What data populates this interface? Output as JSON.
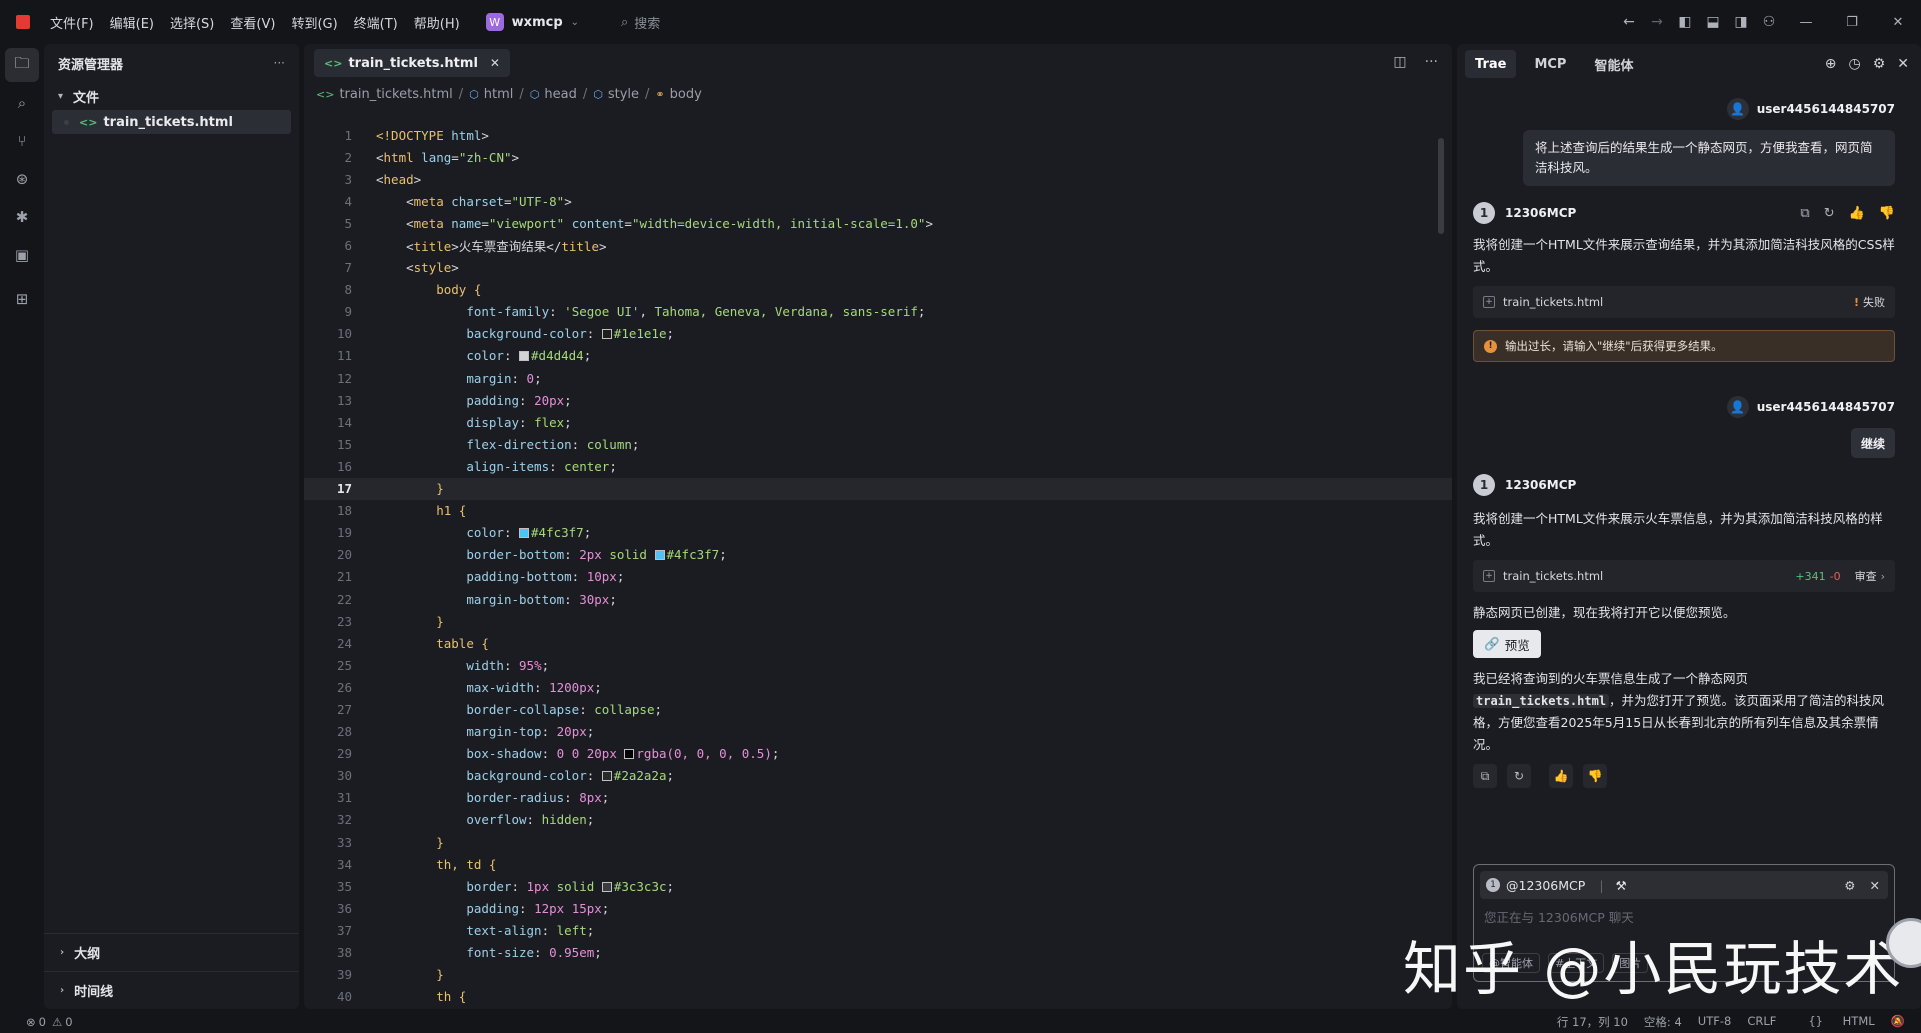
{
  "titlebar": {
    "menu": [
      "文件(F)",
      "编辑(E)",
      "选择(S)",
      "查看(V)",
      "转到(G)",
      "终端(T)",
      "帮助(H)"
    ],
    "workspace_badge": "W",
    "workspace": "wxmcp",
    "search_placeholder": "搜索"
  },
  "explorer": {
    "title": "资源管理器",
    "folder": "文件",
    "file": "train_tickets.html",
    "outline": "大纲",
    "timeline": "时间线"
  },
  "editor": {
    "tab": "train_tickets.html",
    "breadcrumb": [
      "train_tickets.html",
      "html",
      "head",
      "style",
      "body"
    ],
    "current_line": 17,
    "lines": [
      {
        "n": 1,
        "h": "<span class='t'>&lt;!DOCTYPE</span> <span class='a'>html</span>&gt;"
      },
      {
        "n": 2,
        "h": "&lt;<span class='t'>html</span> <span class='a'>lang</span>=<span class='s'>\"zh-CN\"</span>&gt;"
      },
      {
        "n": 3,
        "h": "&lt;<span class='t'>head</span>&gt;"
      },
      {
        "n": 4,
        "h": "    &lt;<span class='t'>meta</span> <span class='a'>charset</span>=<span class='s'>\"UTF-8\"</span>&gt;"
      },
      {
        "n": 5,
        "h": "    &lt;<span class='t'>meta</span> <span class='a'>name</span>=<span class='s'>\"viewport\"</span> <span class='a'>content</span>=<span class='s'>\"width=device-width, initial-scale=1.0\"</span>&gt;"
      },
      {
        "n": 6,
        "h": "    &lt;<span class='t'>title</span>&gt;火车票查询结果&lt;/<span class='t'>title</span>&gt;"
      },
      {
        "n": 7,
        "h": "    &lt;<span class='t'>style</span>&gt;"
      },
      {
        "n": 8,
        "h": "        <span class='sel'>body</span> <span class='sel'>{</span>"
      },
      {
        "n": 9,
        "h": "            <span class='p'>font-family</span>: <span class='s'>'Segoe UI'</span>, <span class='k'>Tahoma, Geneva, Verdana, sans-serif</span>;"
      },
      {
        "n": 10,
        "h": "            <span class='p'>background-color</span>: <span class='sw' style='background:#1e1e1e'></span><span class='k'>#1e1e1e</span>;"
      },
      {
        "n": 11,
        "h": "            <span class='p'>color</span>: <span class='sw' style='background:#d4d4d4'></span><span class='k'>#d4d4d4</span>;"
      },
      {
        "n": 12,
        "h": "            <span class='p'>margin</span>: <span class='v'>0</span>;"
      },
      {
        "n": 13,
        "h": "            <span class='p'>padding</span>: <span class='v'>20px</span>;"
      },
      {
        "n": 14,
        "h": "            <span class='p'>display</span>: <span class='k'>flex</span>;"
      },
      {
        "n": 15,
        "h": "            <span class='p'>flex-direction</span>: <span class='k'>column</span>;"
      },
      {
        "n": 16,
        "h": "            <span class='p'>align-items</span>: <span class='k'>center</span>;"
      },
      {
        "n": 17,
        "h": "        <span class='sel'>}</span>"
      },
      {
        "n": 18,
        "h": "        <span class='sel'>h1 {</span>"
      },
      {
        "n": 19,
        "h": "            <span class='p'>color</span>: <span class='sw' style='background:#4fc3f7'></span><span class='k'>#4fc3f7</span>;"
      },
      {
        "n": 20,
        "h": "            <span class='p'>border-bottom</span>: <span class='v'>2px</span> <span class='k'>solid</span> <span class='sw' style='background:#4fc3f7'></span><span class='k'>#4fc3f7</span>;"
      },
      {
        "n": 21,
        "h": "            <span class='p'>padding-bottom</span>: <span class='v'>10px</span>;"
      },
      {
        "n": 22,
        "h": "            <span class='p'>margin-bottom</span>: <span class='v'>30px</span>;"
      },
      {
        "n": 23,
        "h": "        <span class='sel'>}</span>"
      },
      {
        "n": 24,
        "h": "        <span class='sel'>table {</span>"
      },
      {
        "n": 25,
        "h": "            <span class='p'>width</span>: <span class='v'>95%</span>;"
      },
      {
        "n": 26,
        "h": "            <span class='p'>max-width</span>: <span class='v'>1200px</span>;"
      },
      {
        "n": 27,
        "h": "            <span class='p'>border-collapse</span>: <span class='k'>collapse</span>;"
      },
      {
        "n": 28,
        "h": "            <span class='p'>margin-top</span>: <span class='v'>20px</span>;"
      },
      {
        "n": 29,
        "h": "            <span class='p'>box-shadow</span>: <span class='v'>0 0 20px</span> <span class='sw' style='background:#000'></span><span class='v'>rgba(0, 0, 0, 0.5)</span>;"
      },
      {
        "n": 30,
        "h": "            <span class='p'>background-color</span>: <span class='sw' style='background:#2a2a2a'></span><span class='k'>#2a2a2a</span>;"
      },
      {
        "n": 31,
        "h": "            <span class='p'>border-radius</span>: <span class='v'>8px</span>;"
      },
      {
        "n": 32,
        "h": "            <span class='p'>overflow</span>: <span class='k'>hidden</span>;"
      },
      {
        "n": 33,
        "h": "        <span class='sel'>}</span>"
      },
      {
        "n": 34,
        "h": "        <span class='sel'>th, td {</span>"
      },
      {
        "n": 35,
        "h": "            <span class='p'>border</span>: <span class='v'>1px</span> <span class='k'>solid</span> <span class='sw' style='background:#3c3c3c'></span><span class='k'>#3c3c3c</span>;"
      },
      {
        "n": 36,
        "h": "            <span class='p'>padding</span>: <span class='v'>12px 15px</span>;"
      },
      {
        "n": 37,
        "h": "            <span class='p'>text-align</span>: <span class='k'>left</span>;"
      },
      {
        "n": 38,
        "h": "            <span class='p'>font-size</span>: <span class='v'>0.95em</span>;"
      },
      {
        "n": 39,
        "h": "        <span class='sel'>}</span>"
      },
      {
        "n": 40,
        "h": "        <span class='sel'>th {</span>"
      }
    ]
  },
  "ai": {
    "tabs": [
      "Trae",
      "MCP",
      "智能体"
    ],
    "user": "user4456144845707",
    "user_msg1": "将上述查询后的结果生成一个静态网页，方便我查看，网页简洁科技风。",
    "bot_avatar": "1",
    "bot": "12306MCP",
    "bot_msg1": "我将创建一个HTML文件来展示查询结果，并为其添加简洁科技风格的CSS样式。",
    "file1": "train_tickets.html",
    "file1_status": "失败",
    "warn": "输出过长，请输入\"继续\"后获得更多结果。",
    "user_msg2": "继续",
    "bot_msg2": "我将创建一个HTML文件来展示火车票信息，并为其添加简洁科技风格的样式。",
    "file2": "train_tickets.html",
    "file2_add": "+341",
    "file2_del": "-0",
    "file2_review": "审查",
    "bot_msg3": "静态网页已创建，现在我将打开它以便您预览。",
    "preview": "预览",
    "bot_msg4_a": "我已经将查询到的火车票信息生成了一个静态网页",
    "bot_msg4_code": "train_tickets.html",
    "bot_msg4_b": "，并为您打开了预览。该页面采用了简洁的科技风格，方便您查看2025年5月15日从长春到北京的所有列车信息及其余票情况。",
    "input_agent": "@12306MCP",
    "input_placeholder": "您正在与 12306MCP 聊天",
    "chips": [
      "@智能体",
      "#上下文",
      "图片"
    ],
    "watermark": "知乎 @小民玩技术"
  },
  "status": {
    "errors": "0",
    "warnings": "0",
    "position": "行 17，列 10",
    "spaces": "空格: 4",
    "encoding": "UTF-8",
    "eol": "CRLF",
    "lang": "HTML"
  }
}
